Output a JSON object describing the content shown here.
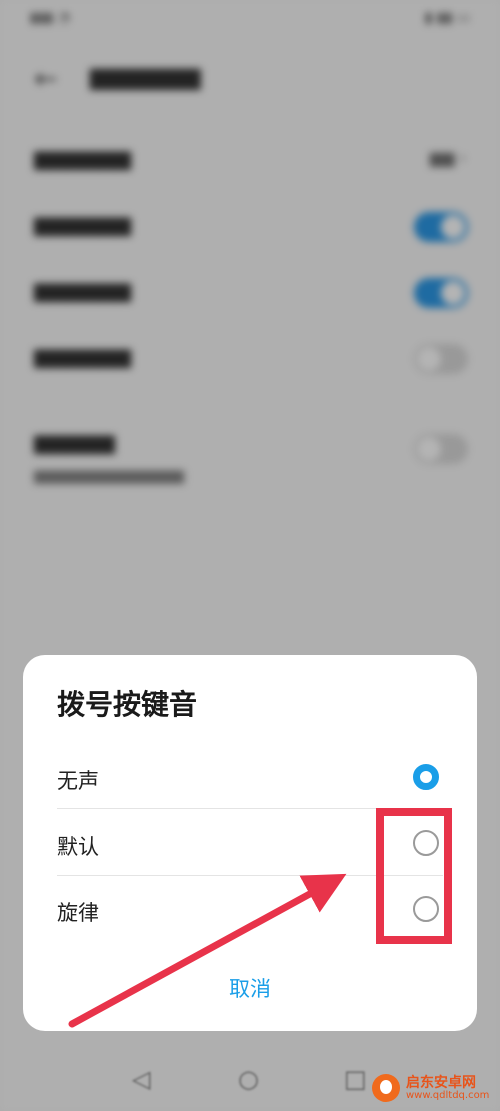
{
  "dialog": {
    "title": "拨号按键音",
    "options": [
      {
        "label": "无声",
        "selected": true
      },
      {
        "label": "默认",
        "selected": false
      },
      {
        "label": "旋律",
        "selected": false
      }
    ],
    "cancel_label": "取消"
  },
  "watermark": {
    "name": "启东安卓网",
    "url": "www.qdltdq.com"
  },
  "colors": {
    "accent": "#1a9ee8",
    "annotation": "#e8334a",
    "dim_overlay": "rgba(40,40,40,0.35)"
  },
  "icons": {
    "back": "back-arrow-icon",
    "nav_back": "nav-back-icon",
    "nav_home": "nav-home-icon",
    "nav_recent": "nav-recent-icon"
  }
}
